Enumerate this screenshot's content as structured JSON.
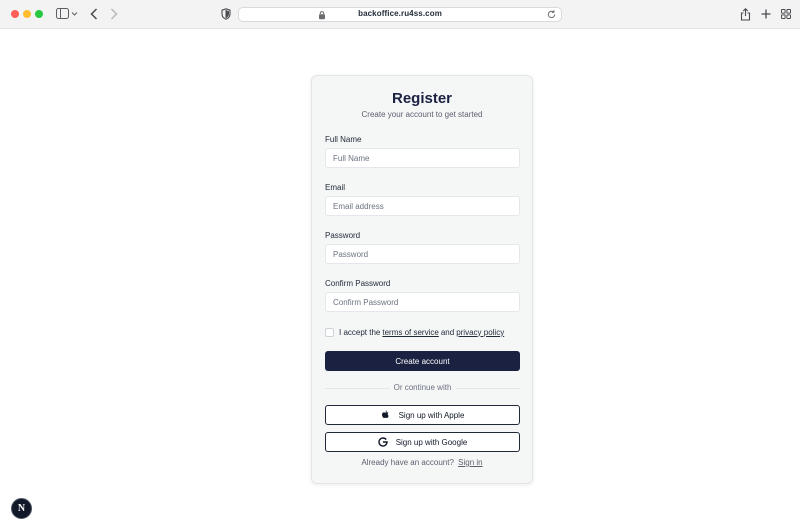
{
  "browser": {
    "url": "backoffice.ru4ss.com",
    "colors": {
      "close": "#ff5f57",
      "minimize": "#febc2e",
      "zoom": "#28c840"
    },
    "icons": [
      "sidebar-icon",
      "chevron-left-icon",
      "chevron-right-icon",
      "shield-icon",
      "lock-icon",
      "reload-icon",
      "share-icon",
      "plus-icon",
      "grid-icon"
    ]
  },
  "register": {
    "title": "Register",
    "subtitle": "Create your account to get started",
    "fields": [
      {
        "label": "Full Name",
        "placeholder": "Full Name",
        "value": ""
      },
      {
        "label": "Email",
        "placeholder": "Email address",
        "value": ""
      },
      {
        "label": "Password",
        "placeholder": "Password",
        "value": ""
      },
      {
        "label": "Confirm Password",
        "placeholder": "Confirm Password",
        "value": ""
      }
    ],
    "terms": {
      "prefix": "I accept the",
      "terms_link": "terms of service",
      "and": "and",
      "privacy_link": "privacy policy",
      "checked": false
    },
    "submit_label": "Create account",
    "divider": "Or continue with",
    "apple_label": "Sign up with Apple",
    "google_label": "Sign up with Google",
    "signin_prompt": "Already have an account?",
    "signin_link": "Sign in",
    "accent_color": "#1a2141"
  },
  "badge": {
    "letter": "N"
  }
}
